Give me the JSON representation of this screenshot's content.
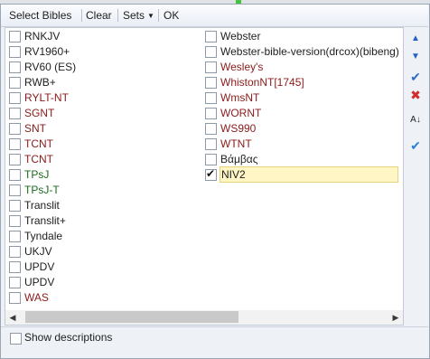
{
  "toolbar": {
    "title": "Select Bibles",
    "clear_label": "Clear",
    "sets_label": "Sets",
    "ok_label": "OK"
  },
  "left_items": [
    {
      "label": "RNKJV",
      "color": "#1e1e1e",
      "checked": false
    },
    {
      "label": "RV1960+",
      "color": "#1e1e1e",
      "checked": false
    },
    {
      "label": "RV60 (ES)",
      "color": "#1e1e1e",
      "checked": false
    },
    {
      "label": "RWB+",
      "color": "#1e1e1e",
      "checked": false
    },
    {
      "label": "RYLT-NT",
      "color": "#8b1a1a",
      "checked": false
    },
    {
      "label": "SGNT",
      "color": "#8b1a1a",
      "checked": false
    },
    {
      "label": "SNT",
      "color": "#8b1a1a",
      "checked": false
    },
    {
      "label": "TCNT",
      "color": "#8b1a1a",
      "checked": false
    },
    {
      "label": "TCNT",
      "color": "#8b1a1a",
      "checked": false
    },
    {
      "label": "TPsJ",
      "color": "#1d6b1d",
      "checked": false
    },
    {
      "label": "TPsJ-T",
      "color": "#1d6b1d",
      "checked": false
    },
    {
      "label": "Translit",
      "color": "#1e1e1e",
      "checked": false
    },
    {
      "label": "Translit+",
      "color": "#1e1e1e",
      "checked": false
    },
    {
      "label": "Tyndale",
      "color": "#1e1e1e",
      "checked": false
    },
    {
      "label": "UKJV",
      "color": "#1e1e1e",
      "checked": false
    },
    {
      "label": "UPDV",
      "color": "#1e1e1e",
      "checked": false
    },
    {
      "label": "UPDV",
      "color": "#1e1e1e",
      "checked": false
    },
    {
      "label": "WAS",
      "color": "#8b1a1a",
      "checked": false
    }
  ],
  "right_items": [
    {
      "label": "Webster",
      "color": "#1e1e1e",
      "checked": false
    },
    {
      "label": "Webster-bible-version(drcox)(bibeng)",
      "color": "#1e1e1e",
      "checked": false
    },
    {
      "label": "Wesley's",
      "color": "#8b1a1a",
      "checked": false
    },
    {
      "label": "WhistonNT[1745]",
      "color": "#8b1a1a",
      "checked": false
    },
    {
      "label": "WmsNT",
      "color": "#8b1a1a",
      "checked": false
    },
    {
      "label": "WORNT",
      "color": "#8b1a1a",
      "checked": false
    },
    {
      "label": "WS990",
      "color": "#8b1a1a",
      "checked": false
    },
    {
      "label": "WTNT",
      "color": "#8b1a1a",
      "checked": false
    },
    {
      "label": "Βάμβας",
      "color": "#1e1e1e",
      "checked": false
    },
    {
      "label": "NIV2",
      "color": "#1e1e1e",
      "checked": true,
      "selected": true
    }
  ],
  "side_buttons": [
    {
      "name": "move-up-icon",
      "glyph": "▲",
      "color": "#1f62c9"
    },
    {
      "name": "move-down-icon",
      "glyph": "▼",
      "color": "#1f62c9"
    },
    {
      "name": "check-all-icon",
      "glyph": "✔",
      "color": "#2e6ec8"
    },
    {
      "name": "uncheck-all-icon",
      "glyph": "✖",
      "color": "#d12b2b"
    },
    {
      "name": "sort-az-icon",
      "glyph": "A↓",
      "color": "#222222"
    },
    {
      "name": "confirm-icon",
      "glyph": "✔",
      "color": "#2e7fd8"
    }
  ],
  "bottom": {
    "show_descriptions_label": "Show descriptions",
    "show_descriptions_checked": false
  },
  "scrollbar": {
    "left_arrow": "◀",
    "right_arrow": "▶"
  }
}
